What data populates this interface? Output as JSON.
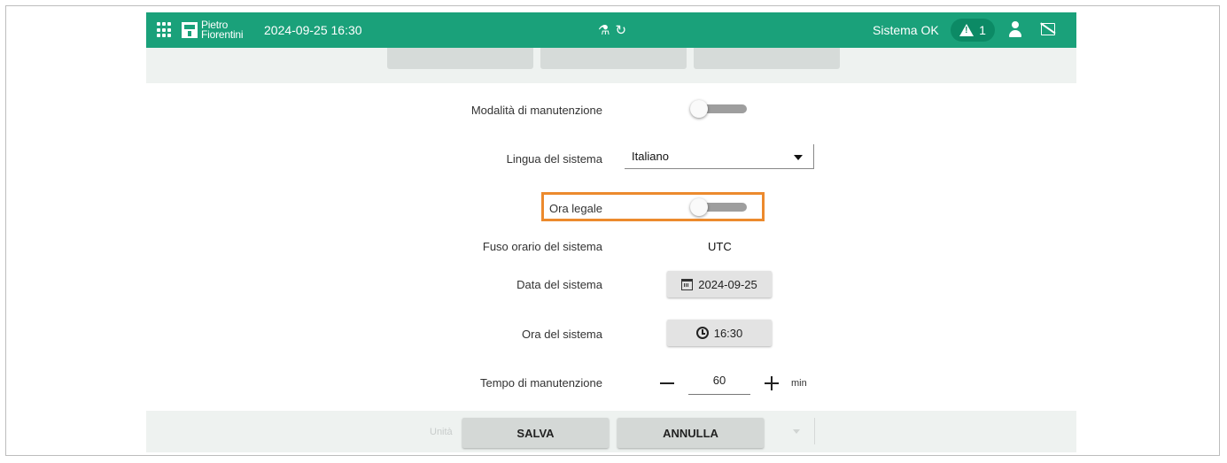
{
  "topbar": {
    "logo_line1": "Pietro",
    "logo_line2": "Fiorentini",
    "datetime": "2024-09-25 16:30",
    "center_icons": [
      "flask-icon",
      "sync-icon"
    ],
    "status": "Sistema OK",
    "alarm_count": "1",
    "color": "#1aa17a"
  },
  "form": {
    "maintenance_mode": {
      "label": "Modalità di manutenzione",
      "enabled": false
    },
    "language": {
      "label": "Lingua del sistema",
      "value": "Italiano"
    },
    "dst": {
      "label": "Ora legale",
      "enabled": false
    },
    "timezone": {
      "label": "Fuso orario del sistema",
      "value": "UTC"
    },
    "date": {
      "label": "Data del sistema",
      "value": "2024-09-25"
    },
    "time": {
      "label": "Ora del sistema",
      "value": "16:30"
    },
    "maintenance_time": {
      "label": "Tempo di manutenzione",
      "value": "60",
      "unit": "min"
    }
  },
  "footer": {
    "ghost_label": "Unità",
    "save_label": "SALVA",
    "cancel_label": "ANNULLA"
  },
  "highlight_color": "#ec8a2d"
}
